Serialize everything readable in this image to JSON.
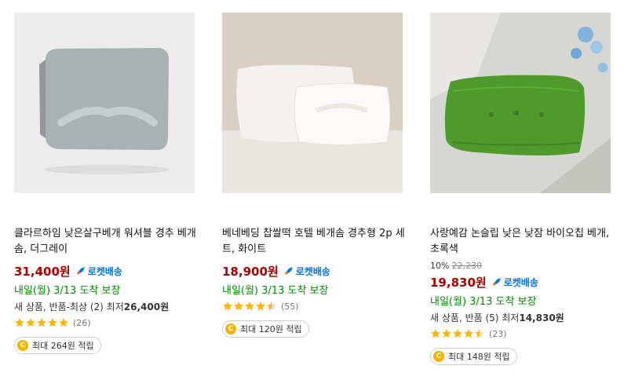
{
  "products": [
    {
      "title": "클라르하임 낮은살구베개 워셔블 경추 베개솜, 더그레이",
      "discount": "",
      "original_price": "",
      "price": "31,400원",
      "rocket": "로켓배송",
      "delivery": "내일(월) 3/13 도착 보장",
      "other_prefix": "새 상품, 반품-최상 (2) 최저",
      "other_price": "26,400원",
      "rating": 5,
      "review_count": "(26)",
      "reward": "최대 264원 적립",
      "image_colors": {
        "bg": "#ececec",
        "item": "#a9b1b3"
      }
    },
    {
      "title": "베네베딩 찹쌀떡 호텔 베개솜 경추형 2p 세트, 화이트",
      "discount": "",
      "original_price": "",
      "price": "18,900원",
      "rocket": "로켓배송",
      "delivery": "내일(월) 3/13 도착 보장",
      "other_prefix": "",
      "other_price": "",
      "rating": 4.5,
      "review_count": "(55)",
      "reward": "최대 120원 적립",
      "image_colors": {
        "bg": "#d9cfc2",
        "item": "#f4f2ee"
      }
    },
    {
      "title": "사랑예감 논슬립 낮은 낮잠 바이오칩 베개, 초록색",
      "discount": "10%",
      "original_price": "22,230",
      "price": "19,830원",
      "rocket": "로켓배송",
      "delivery": "내일(월) 3/13 도착 보장",
      "other_prefix": "새 상품, 반품 (5) 최저",
      "other_price": "14,830원",
      "rating": 4.5,
      "review_count": "(23)",
      "reward": "최대 148원 적립",
      "image_colors": {
        "bg": "#d6d6d2",
        "item": "#4e9a2a"
      }
    }
  ],
  "colors": {
    "price": "#ae0000",
    "rocket": "#0073e9",
    "delivery": "#008c00",
    "star": "#ffb400",
    "coin": "#f4b400"
  },
  "icons": {
    "rocket": "rocket-icon",
    "star": "star-icon",
    "coin": "coin-icon"
  }
}
